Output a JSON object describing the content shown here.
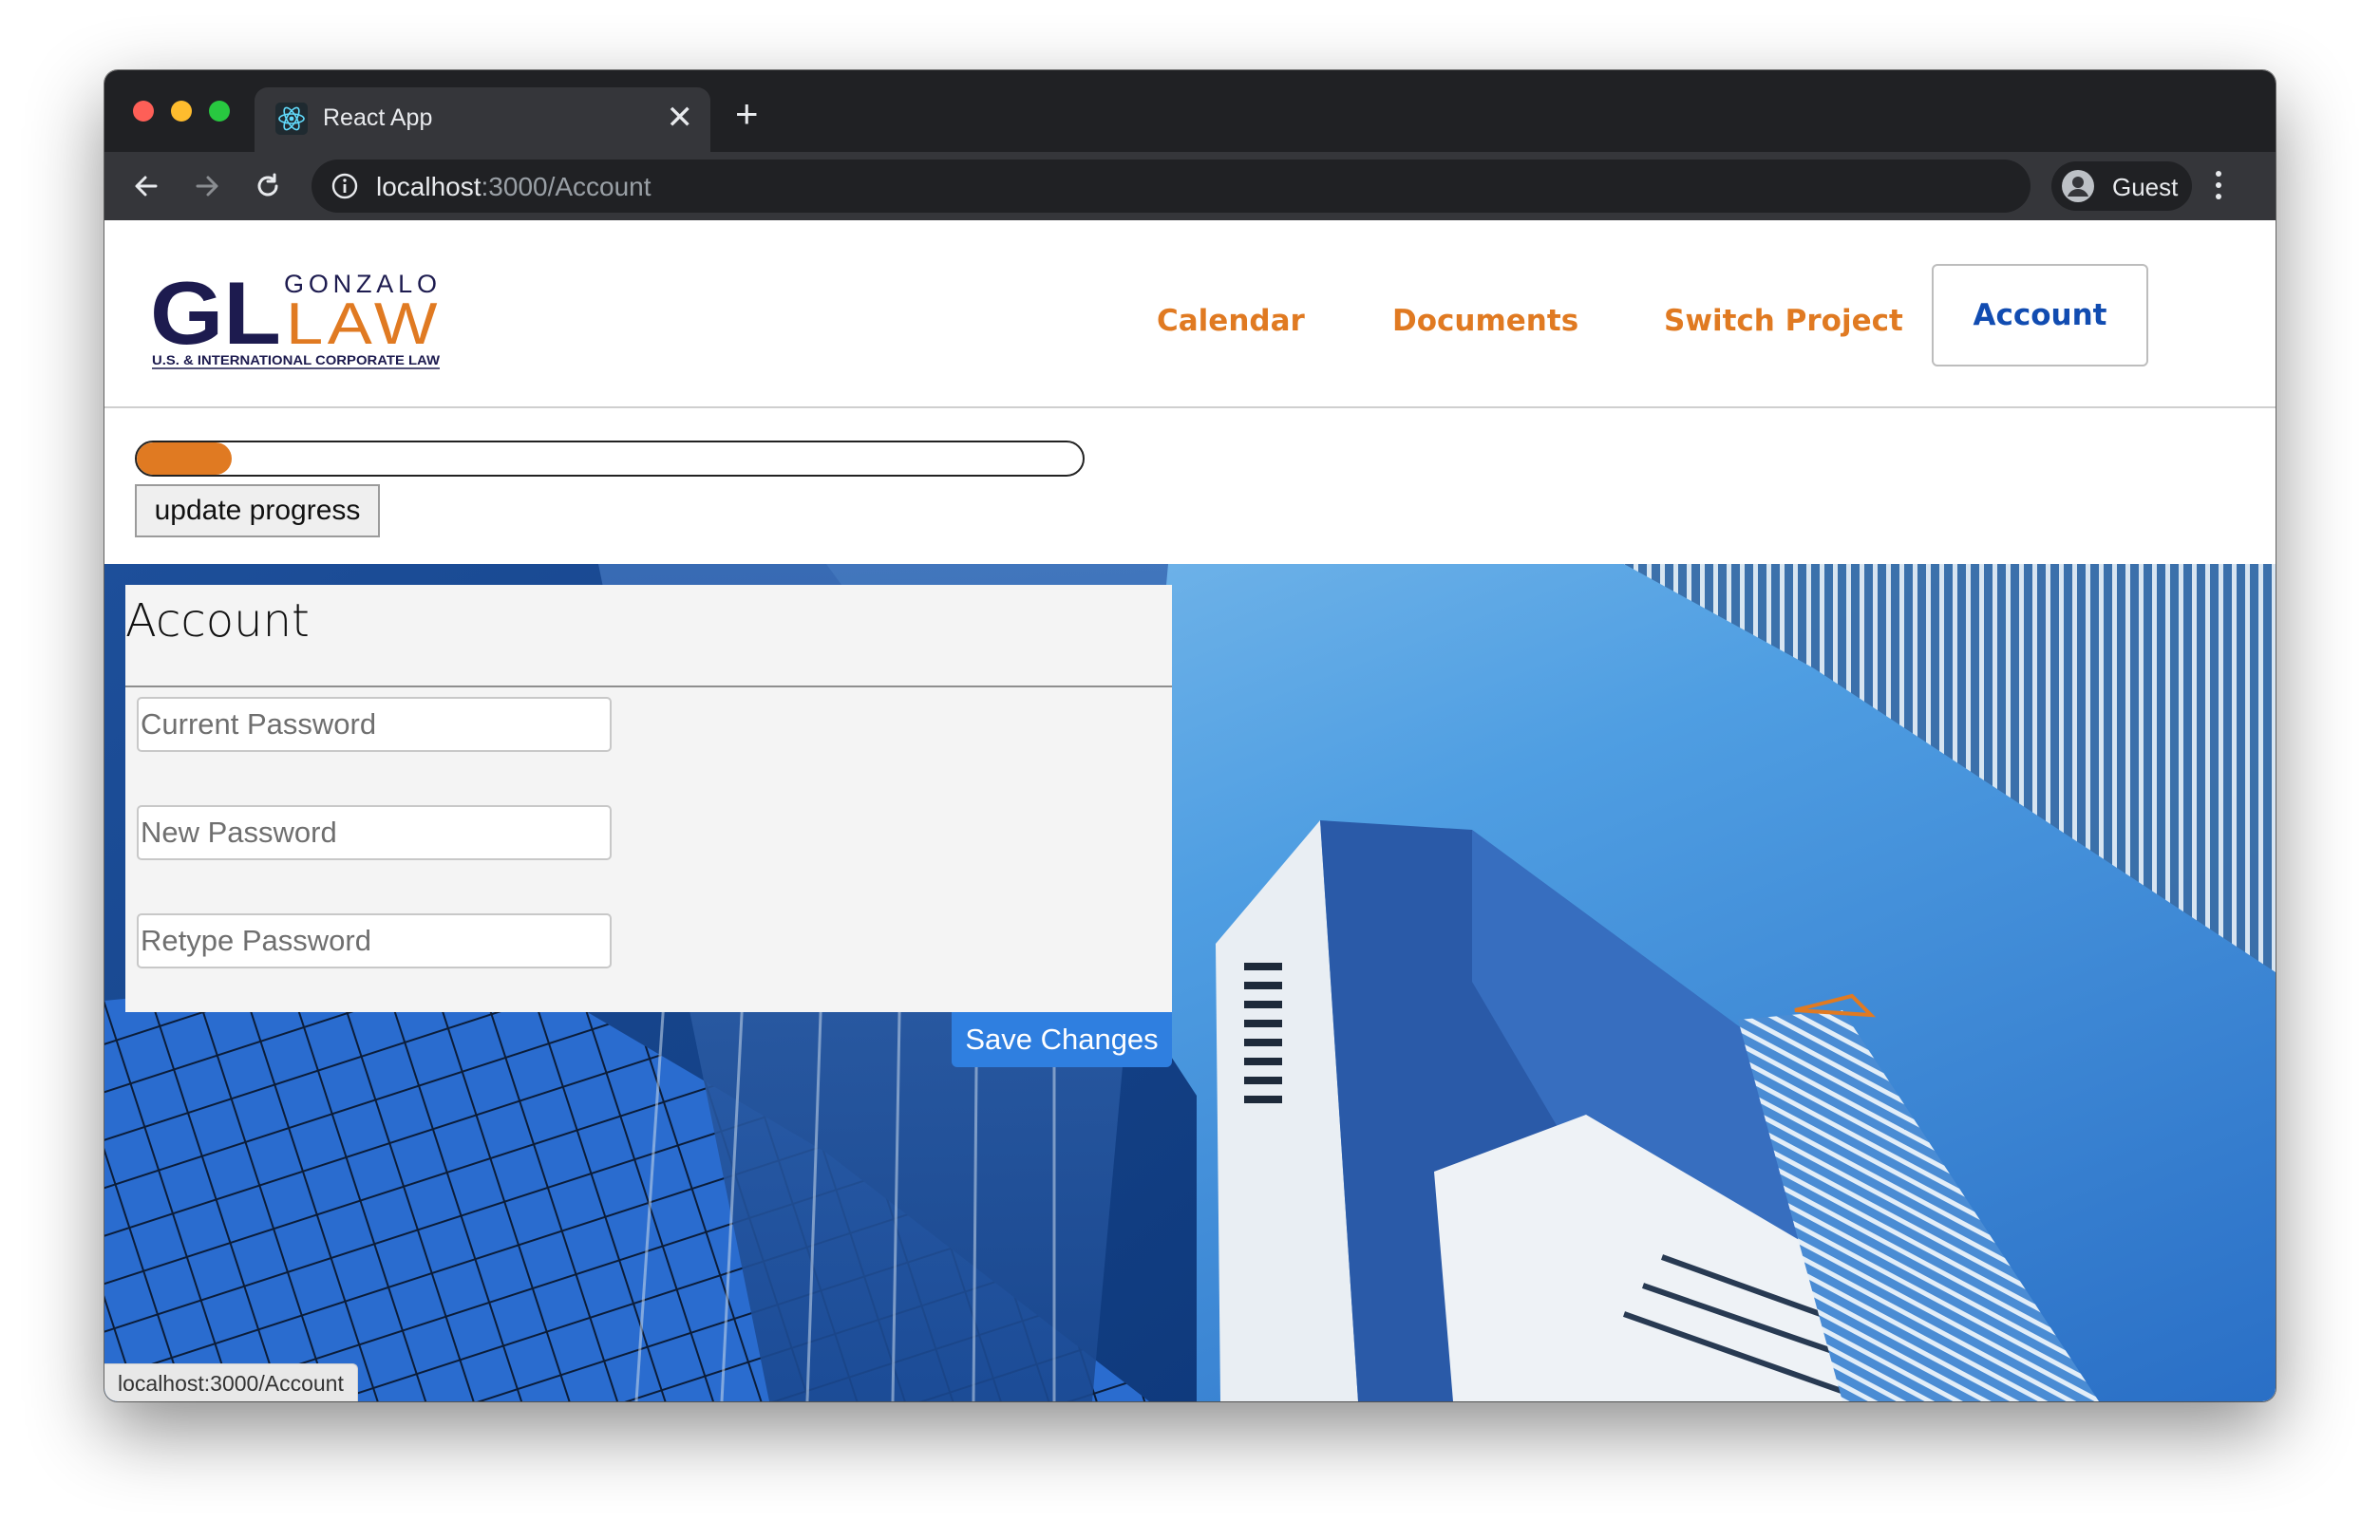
{
  "browser": {
    "tab_title": "React App",
    "tab_close": "✕",
    "new_tab": "+",
    "url_host": "localhost",
    "url_rest": ":3000/Account",
    "profile_label": "Guest"
  },
  "site": {
    "logo": {
      "initials": "GL",
      "top": "GONZALO",
      "main": "LAW",
      "tagline": "U.S. & INTERNATIONAL CORPORATE LAW"
    },
    "nav": {
      "calendar": "Calendar",
      "documents": "Documents",
      "switch_project": "Switch Project",
      "account": "Account"
    },
    "colors": {
      "accent": "#e07a22",
      "nav_active": "#114cb1",
      "primary_button": "#2f7fe0"
    }
  },
  "progress": {
    "value_fraction": 0.1,
    "button_label": "update progress"
  },
  "account": {
    "title": "Account",
    "current_password_placeholder": "Current Password",
    "new_password_placeholder": "New Password",
    "retype_password_placeholder": "Retype Password",
    "save_label": "Save Changes"
  },
  "status_bar": {
    "text": "localhost:3000/Account"
  }
}
